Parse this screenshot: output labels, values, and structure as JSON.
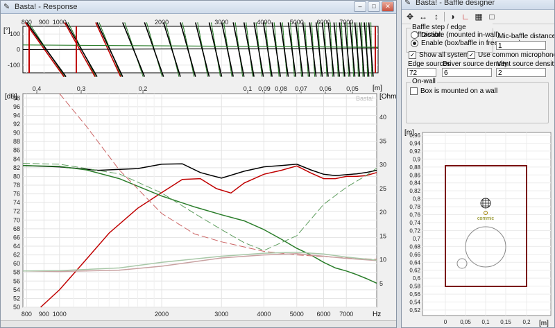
{
  "response_window": {
    "title": "Basta! - Response",
    "phase_panel": {
      "y_unit": "[°]",
      "y_ticks": [
        "100",
        "0",
        "-100"
      ],
      "x_ticks": [
        "800",
        "900",
        "1000",
        "2000",
        "3000",
        "4000",
        "5000",
        "6000",
        "7000"
      ]
    },
    "distance_axis": {
      "unit": "[m]",
      "ticks": [
        "0,4",
        "0,3",
        "0,2",
        "0,1",
        "0,09",
        "0,08",
        "0,07",
        "0,06",
        "0,05"
      ]
    },
    "main_plot": {
      "left_unit": "[dB]",
      "right_unit": "[Ohm]",
      "watermark": "Basta!",
      "left_ticks": [
        "98",
        "96",
        "94",
        "92",
        "90",
        "88",
        "86",
        "84",
        "82",
        "80",
        "78",
        "76",
        "74",
        "72",
        "70",
        "68",
        "66",
        "64",
        "62",
        "60",
        "58",
        "56",
        "54",
        "52",
        "50"
      ],
      "right_ticks": [
        "40",
        "35",
        "30",
        "25",
        "20",
        "15",
        "10",
        "5"
      ],
      "x_ticks": [
        "800",
        "900",
        "1000",
        "2000",
        "3000",
        "4000",
        "5000",
        "6000",
        "7000"
      ],
      "x_unit": "Hz"
    }
  },
  "baffle_window": {
    "title": "Basta! - Baffle designer",
    "toolbar_icons": [
      "move-icon",
      "stretch-horizontal-icon",
      "stretch-vertical-icon",
      "driver-icon",
      "edge-icon",
      "grid-icon",
      "rect-icon"
    ],
    "diffraction_group": {
      "label": "Baffle step / edge diffraction",
      "option_disable": "Disable (mounted in-wall)",
      "option_enable": "Enable (box/baffle in free space)",
      "selected": "enable"
    },
    "mic_distance": {
      "label": "Mic-baffle distance [m]",
      "value": "1"
    },
    "show_all_systems": {
      "label": "Show all systems",
      "checked": true
    },
    "common_mic": {
      "label": "Use common microphone position",
      "checked": true
    },
    "edge_sources": {
      "label": "Edge sources",
      "value": "72"
    },
    "driver_density": {
      "label": "Driver source density",
      "value": "6"
    },
    "vent_density": {
      "label": "Vent source density",
      "value": "2"
    },
    "onwall_group": {
      "label": "On-wall",
      "checkbox_label": "Box is mounted on a wall",
      "checked": false
    },
    "baffle_plot": {
      "y_unit": "[m]",
      "y_ticks": [
        "0,96",
        "0,94",
        "0,92",
        "0,9",
        "0,88",
        "0,86",
        "0,84",
        "0,82",
        "0,8",
        "0,78",
        "0,76",
        "0,74",
        "0,72",
        "0,7",
        "0,68",
        "0,66",
        "0,64",
        "0,62",
        "0,6",
        "0,58",
        "0,56",
        "0,54",
        "0,52"
      ],
      "x_ticks": [
        "0",
        "0,05",
        "0,1",
        "0,15",
        "0,2"
      ],
      "x_unit": "[m]",
      "mic_label": "commic"
    }
  },
  "chart_data": {
    "type": "line",
    "x_label": "Hz",
    "x_scale": "log",
    "xlim": [
      780,
      8600
    ],
    "ylim": [
      50,
      99
    ],
    "y_label": "[dB]",
    "y2_label": "[Ohm]",
    "y2lim": [
      0,
      45
    ],
    "series": [
      {
        "color": "#000000",
        "style": "solid",
        "x": [
          780,
          1000,
          1300,
          1700,
          2000,
          2300,
          2600,
          3000,
          3500,
          4000,
          4500,
          5000,
          5500,
          6000,
          6500,
          7000,
          7500,
          8000,
          8600
        ],
        "y": [
          82.5,
          82.2,
          81.4,
          81.8,
          82.8,
          82.9,
          80.9,
          79.6,
          81.2,
          82.2,
          82.5,
          82.8,
          81.5,
          80.5,
          80.2,
          80.4,
          80.6,
          80.9,
          81.4
        ]
      },
      {
        "color": "#c00000",
        "style": "solid",
        "x": [
          880,
          1000,
          1200,
          1400,
          1700,
          2000,
          2300,
          2600,
          2900,
          3200,
          3500,
          4000,
          4500,
          5000,
          5500,
          6000,
          6500,
          7000,
          7500,
          8000,
          8600
        ],
        "y": [
          50,
          54,
          61,
          67,
          72.7,
          76.3,
          79.3,
          79.5,
          77.2,
          76.2,
          78.5,
          80.5,
          81.4,
          82.4,
          80.8,
          79.5,
          79.5,
          80,
          80,
          80.2,
          80.9
        ]
      },
      {
        "color": "#2a7d2a",
        "style": "solid",
        "x": [
          780,
          1000,
          1200,
          1500,
          2000,
          2500,
          3000,
          3500,
          4000,
          4500,
          5000,
          5500,
          6000,
          6500,
          7000,
          7500,
          8000,
          8600
        ],
        "y": [
          82.5,
          82.3,
          81.5,
          79.5,
          75.5,
          73,
          71.2,
          69.8,
          67.8,
          65.6,
          63.5,
          62,
          60.3,
          59,
          58.3,
          57.5,
          56.6,
          55.5
        ]
      },
      {
        "color": "#cc6666",
        "style": "dashed",
        "x": [
          1000,
          1200,
          1500,
          2000,
          2500,
          3000,
          4000,
          5000,
          6000,
          7000,
          8600
        ],
        "y": [
          99,
          91.5,
          81.5,
          71.5,
          66.8,
          65,
          62.8,
          62,
          61.6,
          61.3,
          61
        ]
      },
      {
        "color": "#5b9b5b",
        "style": "dashed",
        "x": [
          780,
          1000,
          1500,
          2000,
          2500,
          3000,
          3500,
          4000,
          5000,
          6000,
          7000,
          8000,
          8600
        ],
        "y": [
          83,
          82.8,
          80.6,
          76.2,
          71.5,
          67.8,
          64.8,
          63,
          66.4,
          73.6,
          77.5,
          80.2,
          81.9
        ]
      },
      {
        "color": "#c9a2a2",
        "style": "solid",
        "x": [
          780,
          1000,
          1500,
          2000,
          3000,
          4000,
          5000,
          6000,
          7000,
          8600
        ],
        "y": [
          58.3,
          58.2,
          58.5,
          59.4,
          61.3,
          62,
          62.3,
          61.7,
          61.2,
          60.7
        ]
      },
      {
        "color": "#a8c8a8",
        "style": "solid",
        "x": [
          780,
          1000,
          1500,
          2000,
          3000,
          4000,
          5000,
          6000,
          7000,
          8600
        ],
        "y": [
          58.3,
          58.4,
          59,
          60.3,
          61.7,
          62.4,
          62.6,
          62.2,
          61.5,
          60.8
        ]
      }
    ]
  }
}
